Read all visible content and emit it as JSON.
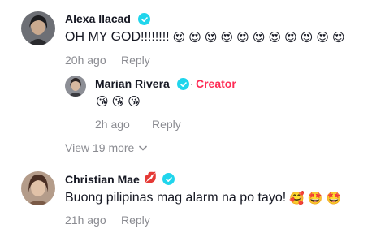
{
  "comments": [
    {
      "user": "Alexa Ilacad",
      "verified": true,
      "text": "OH MY GOD!!!!!!!!",
      "emojis": [
        "😍",
        "😍",
        "😍",
        "😍",
        "😍",
        "😍",
        "😍",
        "😍",
        "😍",
        "😍",
        "😍"
      ],
      "time": "20h ago",
      "reply_label": "Reply",
      "replies": [
        {
          "user": "Marian Rivera",
          "verified": true,
          "separator": "·",
          "badge": "Creator",
          "emojis": [
            "😘",
            "😘",
            "😘"
          ],
          "time": "2h ago",
          "reply_label": "Reply"
        }
      ],
      "view_more": "View 19 more"
    },
    {
      "user": "Christian Mae",
      "user_emoji": "💋",
      "verified": true,
      "text": "Buong pilipinas mag alarm na po tayo!",
      "emojis": [
        "🥰",
        "🤩",
        "🤩"
      ],
      "time": "21h ago",
      "reply_label": "Reply"
    }
  ],
  "colors": {
    "accent": "#fe2c55",
    "verified": "#20d5ec",
    "muted": "#8a8b91",
    "text": "#161823"
  }
}
